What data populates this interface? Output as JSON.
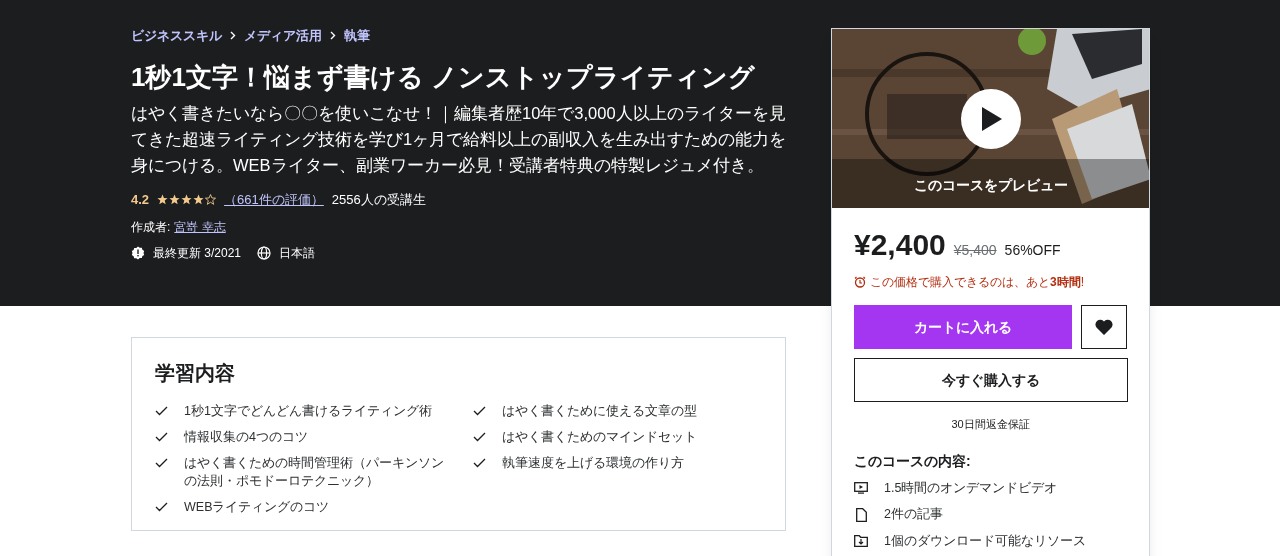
{
  "breadcrumbs": [
    "ビジネススキル",
    "メディア活用",
    "執筆"
  ],
  "title": "1秒1文字！悩まず書ける ノンストップライティング",
  "description": "はやく書きたいなら〇〇を使いこなせ！｜編集者歴10年で3,000人以上のライターを見てきた超速ライティング技術を学び1ヶ月で給料以上の副収入を生み出すための能力を身につける。WEBライター、副業ワーカー必見！受講者特典の特製レジュメ付き。",
  "rating": {
    "score": "4.2",
    "stars": 4,
    "reviews": "（661件の評価）",
    "students": "2556人の受講生"
  },
  "author": {
    "label": "作成者:",
    "name": "宮嵜 幸志"
  },
  "meta": [
    {
      "kind": "updated",
      "text": "最終更新 3/2021"
    },
    {
      "kind": "language",
      "text": "日本語"
    }
  ],
  "learning": {
    "heading": "学習内容",
    "items": [
      {
        "text": "1秒1文字でどんどん書けるライティング術"
      },
      {
        "text": "はやく書くために使える文章の型"
      },
      {
        "text": "情報収集の4つのコツ"
      },
      {
        "text": "はやく書くためのマインドセット"
      },
      {
        "text": "はやく書くための時間管理術（パーキンソンの法則・ポモドーロテクニック）"
      },
      {
        "text": "執筆速度を上げる環境の作り方"
      },
      {
        "text": "WEBライティングのコツ"
      }
    ]
  },
  "sidebar": {
    "preview": {
      "caption": "このコースをプレビュー"
    },
    "price": "¥2,400",
    "original_price": "¥5,400",
    "discount": "56%OFF",
    "timer": "この価格で購入できるのは、あと**3時間**!",
    "add_to_cart": "カートに入れる",
    "buy_now": "今すぐ購入する",
    "guarantee": "30日間返金保証",
    "includes_heading": "このコースの内容:",
    "includes": [
      {
        "kind": "video",
        "text": "1.5時間のオンデマンドビデオ"
      },
      {
        "kind": "article",
        "text": "2件の記事"
      },
      {
        "kind": "download",
        "text": "1個のダウンロード可能なリソース"
      }
    ]
  }
}
